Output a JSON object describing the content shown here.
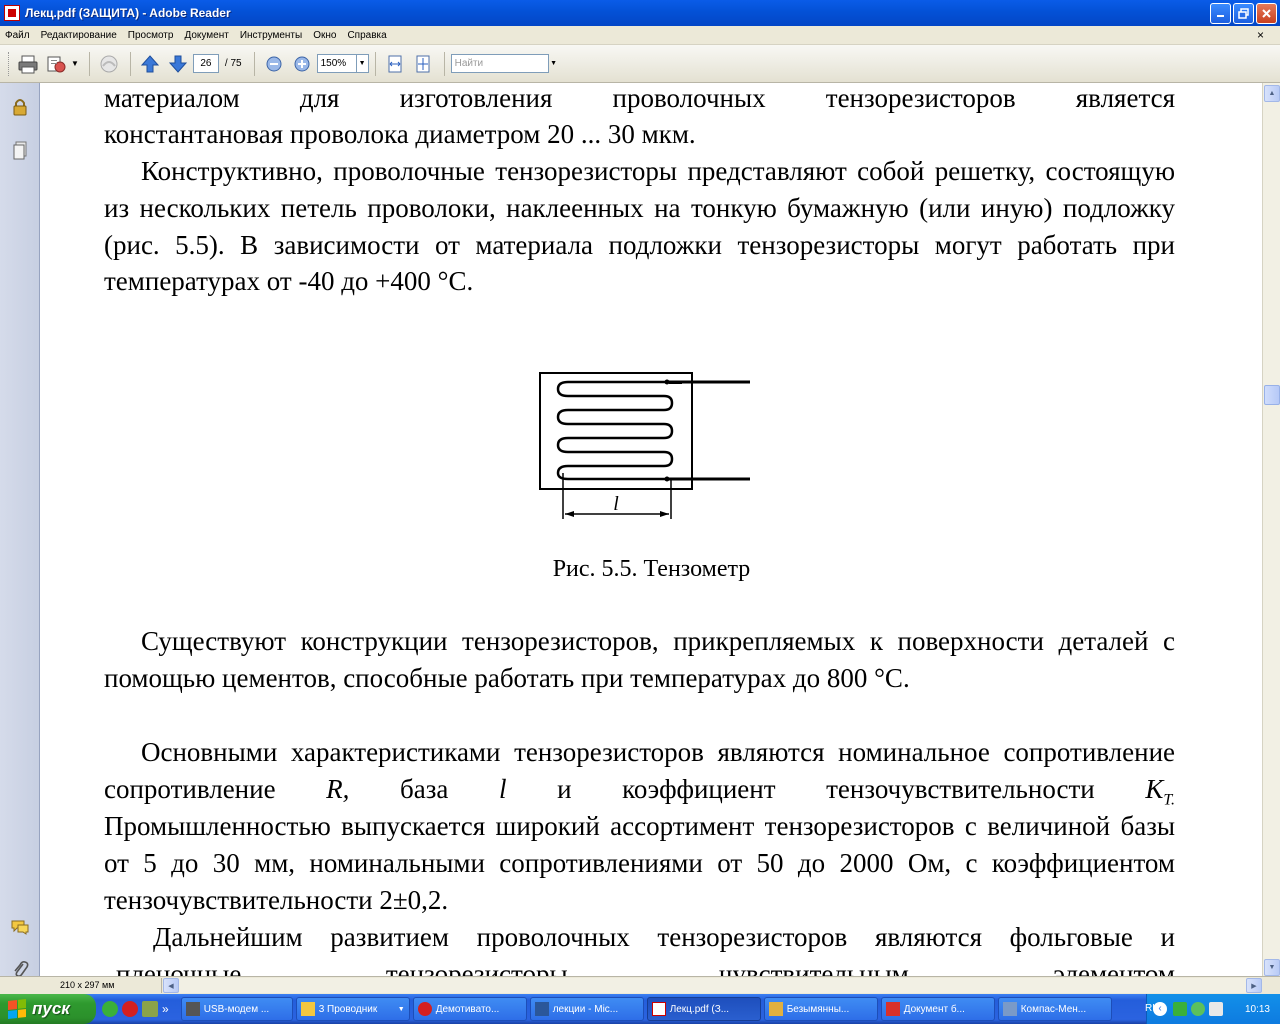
{
  "window": {
    "title": "Лекц.pdf (ЗАЩИТА) - Adobe Reader"
  },
  "menu": {
    "items": [
      "Файл",
      "Редактирование",
      "Просмотр",
      "Документ",
      "Инструменты",
      "Окно",
      "Справка"
    ],
    "close_glyph": "×"
  },
  "toolbar": {
    "page_current": "26",
    "page_total": "/ 75",
    "zoom": "150%",
    "find_placeholder": "Найти"
  },
  "document": {
    "para1_line": "материалом для изготовления проволочных тензорезисторов является",
    "para1_end": "константановая проволока диаметром 20 ... 30 мкм.",
    "para2": "Конструктивно, проволочные тензорезисторы представляют собой решетку, состоящую из нескольких петель проволоки, наклеенных на тонкую бумажную (или иную) подложку (рис. 5.5). В зависимости от материала подложки тензорезисторы могут работать при температурах от -40 до +400 °С.",
    "figure_label": "l",
    "caption": "Рис. 5.5.  Тензометр",
    "para3": "Существуют конструкции тензорезисторов, прикрепляемых к поверхности деталей с помощью цементов, способные работать при температурах до 800 °С.",
    "para4_a": "Основными характеристиками тензорезисторов являются номинальное сопротивление",
    "para4_R": "R,",
    "para4_b": "база",
    "para4_l": "l",
    "para4_c": "и коэффициент тензочувствительности",
    "para4_K": "K",
    "para4_Ksub": "T.",
    "para4_d": "Промышленностью выпускается широкий ассортимент тензорезисторов с величиной базы от 5 до 30 мм, номинальными сопротивлениями от 50 до 2000 Ом, с коэффициентом тензочувствительности 2±0,2.",
    "para5": "Дальнейшим развитием проволочных тензорезисторов являются фольговые и пленочные тензорезисторы, чувствительным элементом"
  },
  "status": {
    "page_size": "210 x 297 мм"
  },
  "taskbar": {
    "start_label": "пуск",
    "tasks": [
      "USB-модем ...",
      "3 Проводник",
      "Демотивато...",
      "лекции - Mic...",
      "Лекц.pdf (З...",
      "Безымянны...",
      "Документ б...",
      "Компас-Мен..."
    ],
    "chevron": "»",
    "lang": "RU",
    "clock": "10:13"
  },
  "colors": {
    "titlebar": "#0451d6",
    "taskbar": "#245edb",
    "start": "#2f9a2f",
    "tray": "#0e7be0",
    "nav_panel": "#d5dbea"
  }
}
